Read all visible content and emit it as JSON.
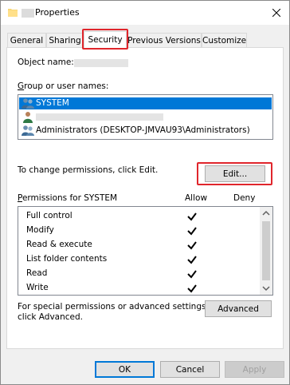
{
  "window": {
    "title": "Properties"
  },
  "tabs": [
    {
      "label": "General"
    },
    {
      "label": "Sharing"
    },
    {
      "label": "Security"
    },
    {
      "label": "Previous Versions"
    },
    {
      "label": "Customize"
    }
  ],
  "security": {
    "object_name_label": "Object name:",
    "group_label": "Group or user names:",
    "users": [
      {
        "name": "SYSTEM",
        "selected": true
      },
      {
        "name": "",
        "selected": false
      },
      {
        "name": "Administrators (DESKTOP-JMVAU93\\Administrators)",
        "selected": false
      }
    ],
    "change_text": "To change permissions, click Edit.",
    "edit_label": "Edit...",
    "permissions_label": "Permissions for SYSTEM",
    "allow_header": "Allow",
    "deny_header": "Deny",
    "permissions": [
      {
        "name": "Full control",
        "allow": true,
        "deny": false
      },
      {
        "name": "Modify",
        "allow": true,
        "deny": false
      },
      {
        "name": "Read & execute",
        "allow": true,
        "deny": false
      },
      {
        "name": "List folder contents",
        "allow": true,
        "deny": false
      },
      {
        "name": "Read",
        "allow": true,
        "deny": false
      },
      {
        "name": "Write",
        "allow": true,
        "deny": false
      }
    ],
    "advanced_text_1": "For special permissions or advanced settings,",
    "advanced_text_2": "click Advanced.",
    "advanced_label": "Advanced"
  },
  "footer": {
    "ok_label": "OK",
    "cancel_label": "Cancel",
    "apply_label": "Apply"
  },
  "colors": {
    "highlight": "#e0262c",
    "selection": "#0078d7"
  }
}
